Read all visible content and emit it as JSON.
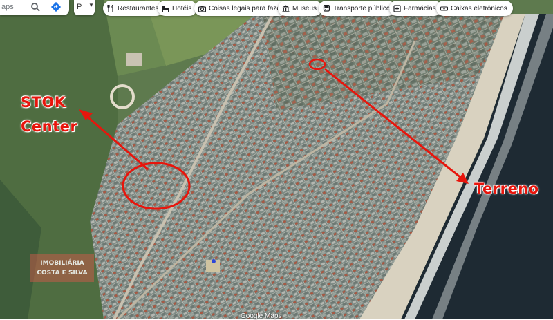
{
  "search": {
    "partial_text": "aps"
  },
  "layer_select": {
    "value": "P"
  },
  "categories": [
    {
      "label": "Restaurantes",
      "icon": "fork-knife-icon"
    },
    {
      "label": "Hotéis",
      "icon": "bed-icon"
    },
    {
      "label": "Coisas legais para fazer",
      "icon": "camera-icon"
    },
    {
      "label": "Museus",
      "icon": "museum-icon"
    },
    {
      "label": "Transporte público",
      "icon": "bus-icon"
    },
    {
      "label": "Farmácias",
      "icon": "pharmacy-icon"
    },
    {
      "label": "Caixas eletrônicos",
      "icon": "atm-icon"
    }
  ],
  "annotations": {
    "stok_line1": "STOK",
    "stok_line2": "Center",
    "terreno": "Terreno",
    "annotation_color": "#e8150c"
  },
  "watermark": {
    "line1": "IMOBILIÁRIA",
    "line2": "COSTA E SILVA"
  },
  "credit": "Google Maps"
}
